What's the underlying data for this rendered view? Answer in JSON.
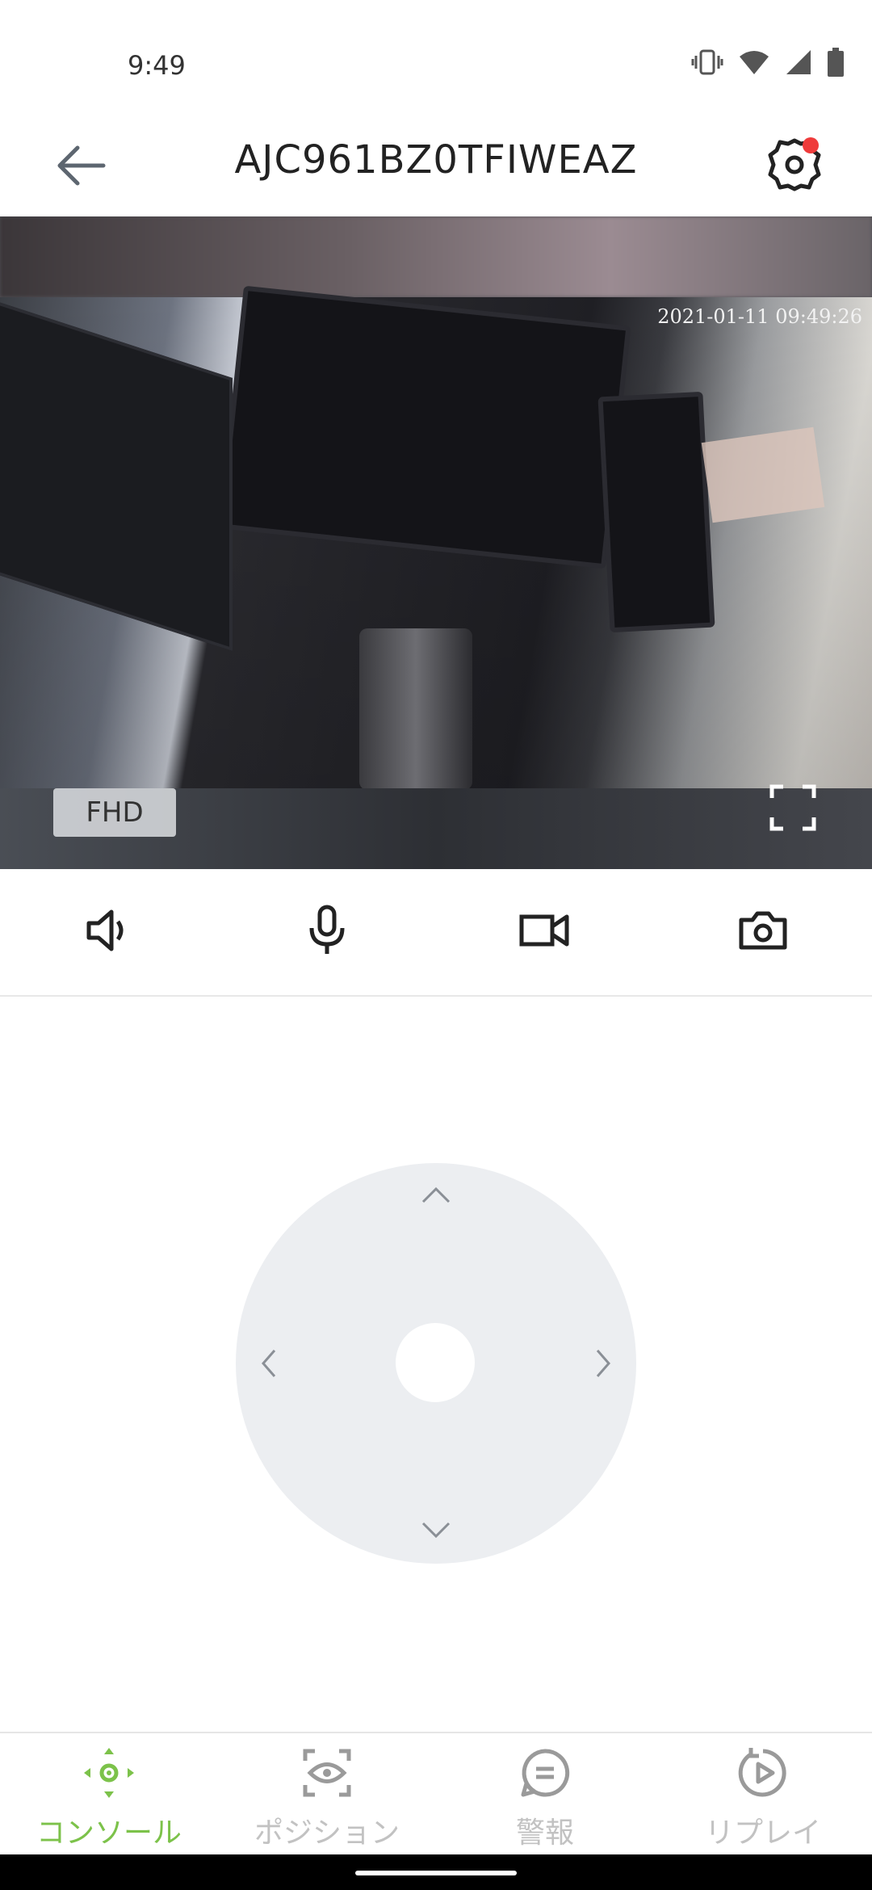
{
  "status_bar": {
    "time": "9:49",
    "icons": [
      "vibrate-icon",
      "wifi-icon",
      "signal-icon",
      "battery-icon"
    ]
  },
  "header": {
    "title": "AJC961BZ0TFIWEAZ",
    "back_icon": "arrow-left-icon",
    "settings_icon": "gear-icon",
    "badge_color": "#ef3b3b"
  },
  "video": {
    "timestamp": "2021-01-11 09:49:26",
    "quality_label": "FHD",
    "fullscreen_icon": "fullscreen-icon"
  },
  "controls": [
    {
      "name": "speaker-icon"
    },
    {
      "name": "microphone-icon"
    },
    {
      "name": "record-video-icon"
    },
    {
      "name": "snapshot-camera-icon"
    }
  ],
  "ptz": {
    "up": "chevron-up-icon",
    "down": "chevron-down-icon",
    "left": "chevron-left-icon",
    "right": "chevron-right-icon"
  },
  "bottom_nav": {
    "active_color": "#7cc24a",
    "inactive_color": "#c2c2c2",
    "items": [
      {
        "label": "コンソール",
        "icon": "console-move-icon",
        "active": true
      },
      {
        "label": "ポジション",
        "icon": "position-eye-icon",
        "active": false
      },
      {
        "label": "警報",
        "icon": "alarm-message-icon",
        "active": false
      },
      {
        "label": "リプレイ",
        "icon": "replay-icon",
        "active": false
      }
    ]
  }
}
